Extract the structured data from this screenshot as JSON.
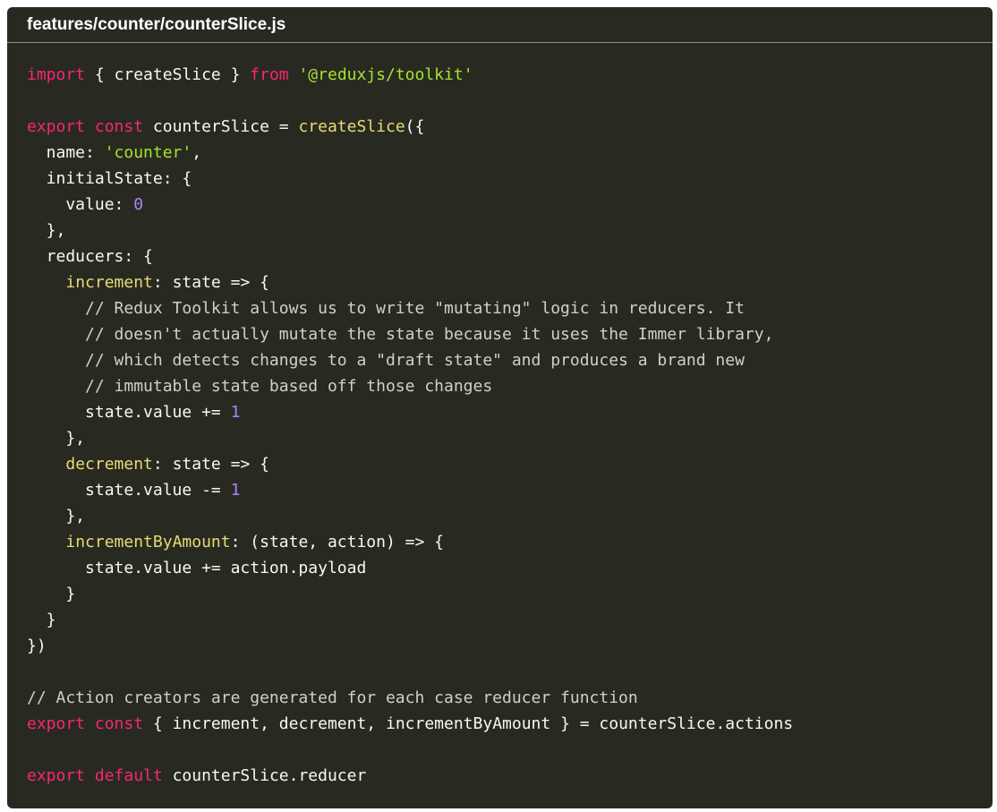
{
  "file_title": "features/counter/counterSlice.js",
  "colors": {
    "background": "#282a22",
    "keyword": "#f92672",
    "string": "#a6e22e",
    "function": "#e6db74",
    "number": "#ae81ff",
    "comment": "#d0d0c8",
    "plain": "#f8f8f2"
  },
  "code_lines": [
    [
      [
        "keyword",
        "import"
      ],
      [
        "plain",
        " { createSlice } "
      ],
      [
        "keyword",
        "from"
      ],
      [
        "plain",
        " "
      ],
      [
        "string",
        "'@reduxjs/toolkit'"
      ]
    ],
    [],
    [
      [
        "keyword",
        "export"
      ],
      [
        "plain",
        " "
      ],
      [
        "keyword",
        "const"
      ],
      [
        "plain",
        " counterSlice = "
      ],
      [
        "func",
        "createSlice"
      ],
      [
        "plain",
        "({"
      ]
    ],
    [
      [
        "plain",
        "  name: "
      ],
      [
        "string",
        "'counter'"
      ],
      [
        "plain",
        ","
      ]
    ],
    [
      [
        "plain",
        "  initialState: {"
      ]
    ],
    [
      [
        "plain",
        "    value: "
      ],
      [
        "number",
        "0"
      ]
    ],
    [
      [
        "plain",
        "  },"
      ]
    ],
    [
      [
        "plain",
        "  reducers: {"
      ]
    ],
    [
      [
        "plain",
        "    "
      ],
      [
        "func",
        "increment"
      ],
      [
        "plain",
        ": state => {"
      ]
    ],
    [
      [
        "comment",
        "      // Redux Toolkit allows us to write \"mutating\" logic in reducers. It"
      ]
    ],
    [
      [
        "comment",
        "      // doesn't actually mutate the state because it uses the Immer library,"
      ]
    ],
    [
      [
        "comment",
        "      // which detects changes to a \"draft state\" and produces a brand new"
      ]
    ],
    [
      [
        "comment",
        "      // immutable state based off those changes"
      ]
    ],
    [
      [
        "plain",
        "      state.value += "
      ],
      [
        "number",
        "1"
      ]
    ],
    [
      [
        "plain",
        "    },"
      ]
    ],
    [
      [
        "plain",
        "    "
      ],
      [
        "func",
        "decrement"
      ],
      [
        "plain",
        ": state => {"
      ]
    ],
    [
      [
        "plain",
        "      state.value -= "
      ],
      [
        "number",
        "1"
      ]
    ],
    [
      [
        "plain",
        "    },"
      ]
    ],
    [
      [
        "plain",
        "    "
      ],
      [
        "func",
        "incrementByAmount"
      ],
      [
        "plain",
        ": (state, action) => {"
      ]
    ],
    [
      [
        "plain",
        "      state.value += action.payload"
      ]
    ],
    [
      [
        "plain",
        "    }"
      ]
    ],
    [
      [
        "plain",
        "  }"
      ]
    ],
    [
      [
        "plain",
        "})"
      ]
    ],
    [],
    [
      [
        "comment",
        "// Action creators are generated for each case reducer function"
      ]
    ],
    [
      [
        "keyword",
        "export"
      ],
      [
        "plain",
        " "
      ],
      [
        "keyword",
        "const"
      ],
      [
        "plain",
        " { increment, decrement, incrementByAmount } = counterSlice.actions"
      ]
    ],
    [],
    [
      [
        "keyword",
        "export"
      ],
      [
        "plain",
        " "
      ],
      [
        "keyword",
        "default"
      ],
      [
        "plain",
        " counterSlice.reducer"
      ]
    ]
  ]
}
